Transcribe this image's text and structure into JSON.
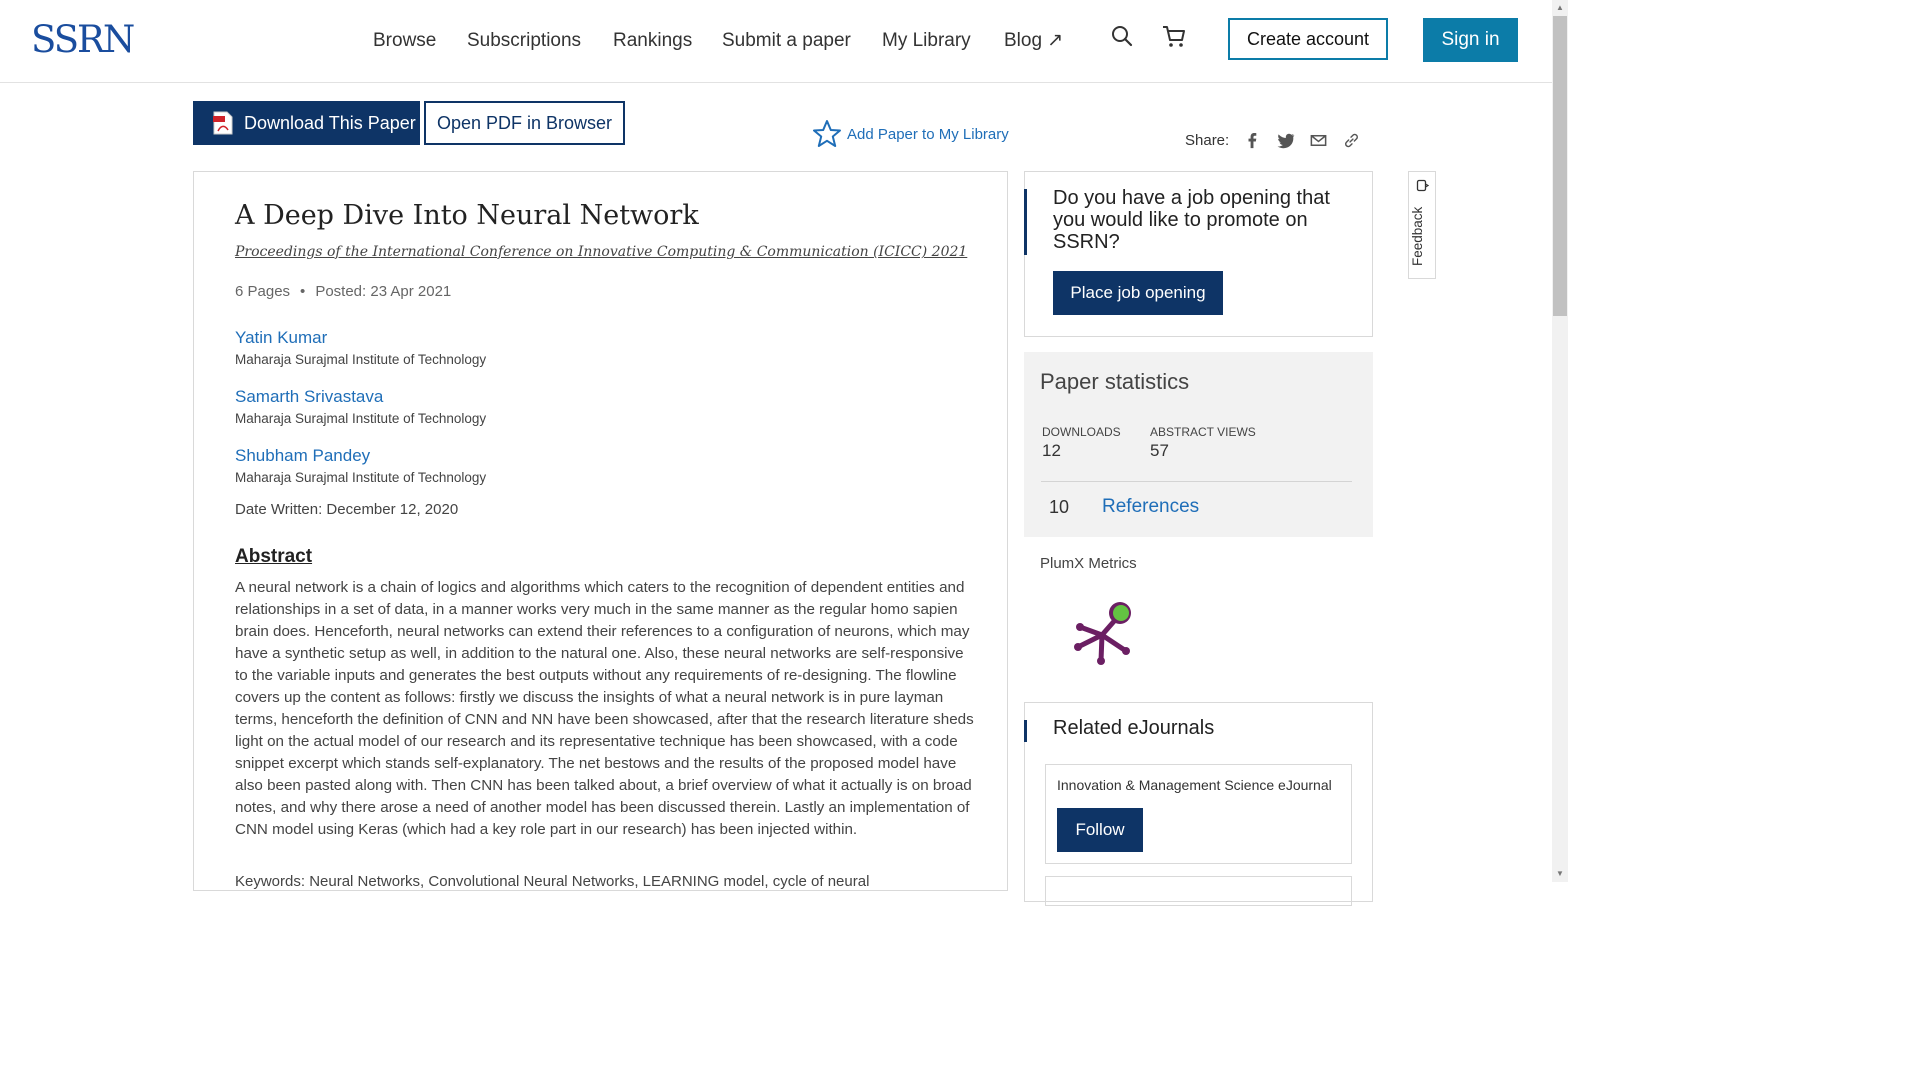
{
  "header": {
    "logo": "SSRN",
    "nav": [
      {
        "label": "Browse"
      },
      {
        "label": "Subscriptions"
      },
      {
        "label": "Rankings"
      },
      {
        "label": "Submit a paper"
      },
      {
        "label": "My Library"
      },
      {
        "label": "Blog ↗"
      }
    ],
    "search_icon": "search-icon",
    "cart_icon": "cart-icon",
    "create_account": "Create account",
    "sign_in": "Sign in"
  },
  "actions": {
    "download": "Download This Paper",
    "open_pdf": "Open PDF in Browser",
    "add_library": "Add Paper to My Library",
    "share_label": "Share:",
    "share_icons": [
      "facebook-icon",
      "twitter-icon",
      "email-icon",
      "link-icon"
    ]
  },
  "paper": {
    "title": "A Deep Dive Into Neural Network",
    "proceedings": "Proceedings of the International Conference on Innovative Computing & Communication (ICICC) 2021",
    "pages": "6 Pages",
    "posted": "Posted: 23 Apr 2021",
    "authors": [
      {
        "name": "Yatin Kumar",
        "affiliation": "Maharaja Surajmal Institute of Technology"
      },
      {
        "name": "Samarth Srivastava",
        "affiliation": "Maharaja Surajmal Institute of Technology"
      },
      {
        "name": "Shubham Pandey",
        "affiliation": "Maharaja Surajmal Institute of Technology"
      }
    ],
    "date_written": "Date Written: December 12, 2020",
    "abstract_heading": "Abstract",
    "abstract": "A neural network is a chain of logics and algorithms which caters to the recognition of dependent entities and relationships in a set of data, in a manner works very much in the same manner as the regular homo sapien brain does. Henceforth, neural networks can extend their references to a configuration of neurons, which may have a synthetic setup as well, in addition to the natural one. Also, these neural networks are self-responsive to the variable inputs and generates the best outputs without any requirements of re-designing. The flowline covers up the content as follows: firstly we discuss the insights of what a neural network is in pure layman terms, henceforth the definition of CNN and NN have been showcased, after that the research literature sheds light on the actual model of our research and its representative technique has been showcased, with a code snippet excerpt which stands self-explanatory. The net bestows and the results of the proposed model have also been pasted along with. Then CNN has been talked about, a brief overview of what it actually is on broad notes, and why there arose a need of another model has been discussed therein. Lastly an implementation of CNN model using Keras (which had a key role part in our research) has been injected within.",
    "keywords": "Keywords: Neural Networks, Convolutional Neural Networks, LEARNING model, cycle of neural"
  },
  "job": {
    "question": "Do you have a job opening that you would like to promote on SSRN?",
    "button": "Place job opening"
  },
  "stats": {
    "title": "Paper statistics",
    "downloads_label": "DOWNLOADS",
    "downloads": "12",
    "views_label": "ABSTRACT VIEWS",
    "views": "57",
    "references_count": "10",
    "references_label": "References"
  },
  "plumx": {
    "title": "PlumX Metrics"
  },
  "ejournals": {
    "title": "Related eJournals",
    "items": [
      {
        "name": "Innovation & Management Science eJournal",
        "button": "Follow"
      }
    ]
  },
  "feedback": {
    "label": "Feedback"
  },
  "colors": {
    "brand": "#0c7ca8",
    "navy": "#0e3466",
    "link": "#1f6eb8"
  }
}
